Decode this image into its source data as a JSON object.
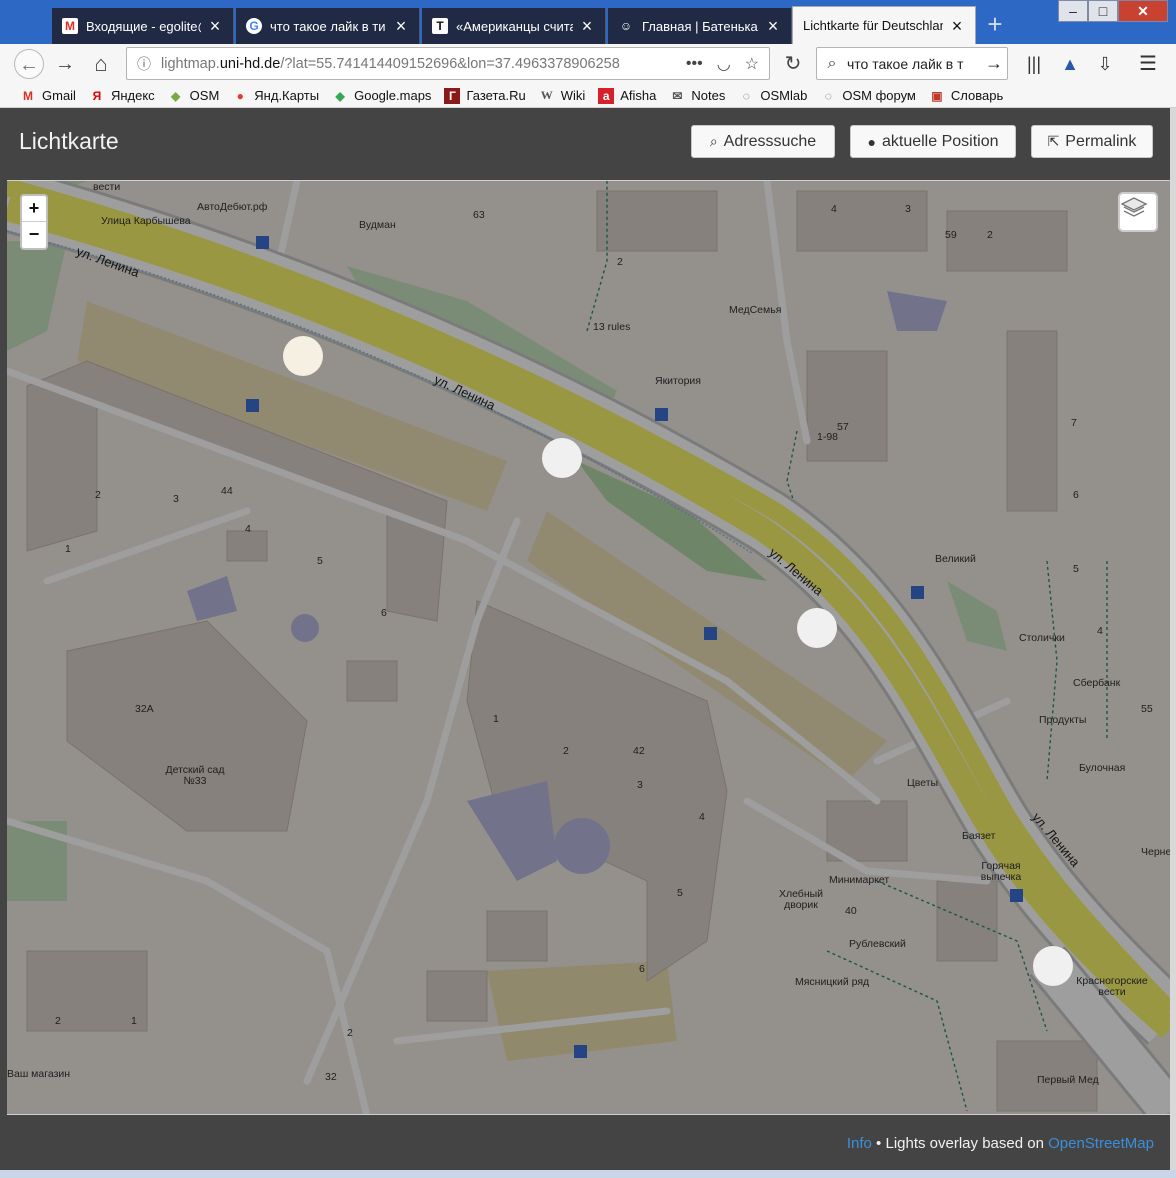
{
  "tabs": [
    {
      "title": "Входящие - egolite@",
      "icon": "M",
      "icon_color": "#d93025"
    },
    {
      "title": "что такое лайк в ти",
      "icon": "G",
      "icon_color": "#4285f4"
    },
    {
      "title": "«Американцы счита",
      "icon": "T",
      "icon_color": "#ffffff"
    },
    {
      "title": "Главная | Батенька,",
      "icon": "☺",
      "icon_color": "#ffffff"
    },
    {
      "title": "Lichtkarte für Deutschlan",
      "icon": "",
      "icon_color": "#ffffff",
      "active": true
    }
  ],
  "window": {
    "minimize": "–",
    "maximize": "□",
    "close": "✕"
  },
  "nav": {
    "back": "←",
    "forward": "→",
    "home": "⌂",
    "url_prefix": "lightmap.",
    "url_domain": "uni-hd.de",
    "url_rest": "/?lat=55.741414409152696&lon=37.4963378906258",
    "reload": "↻",
    "search_value": "что такое лайк в т",
    "search_go": "→"
  },
  "bookmarks": [
    {
      "label": "Gmail",
      "icon": "M",
      "color": "#d93025"
    },
    {
      "label": "Яндекс",
      "icon": "Я",
      "color": "#e00000"
    },
    {
      "label": "OSM",
      "icon": "◆",
      "color": "#7aa843"
    },
    {
      "label": "Янд.Карты",
      "icon": "●",
      "color": "#e63a2e"
    },
    {
      "label": "Google.maps",
      "icon": "◆",
      "color": "#34a853"
    },
    {
      "label": "Газета.Ru",
      "icon": "Г",
      "color": "#8b1a1a"
    },
    {
      "label": "Wiki",
      "icon": "W",
      "color": "#555555"
    },
    {
      "label": "Afisha",
      "icon": "a",
      "color": "#d6202a"
    },
    {
      "label": "Notes",
      "icon": "✉",
      "color": "#555555"
    },
    {
      "label": "OSMlab",
      "icon": "◌",
      "color": "#555555"
    },
    {
      "label": "OSM форум",
      "icon": "◌",
      "color": "#555555"
    },
    {
      "label": "Словарь",
      "icon": "▣",
      "color": "#c0392b"
    }
  ],
  "app": {
    "title": "Lichtkarte",
    "buttons": {
      "address_search": "Adresssuche",
      "current_position": "aktuelle Position",
      "permalink": "Permalink"
    },
    "zoom_in": "+",
    "zoom_out": "−"
  },
  "map": {
    "road_labels": [
      "ул. Ленина",
      "ул. Ленина",
      "ул. Ленина",
      "ул. Ленина"
    ],
    "poi_labels": [
      "вести",
      "АвтоДебют.рф",
      "Улица Карбышева",
      "Вудман",
      "13 rules",
      "МедСемья",
      "Якитория",
      "Великий",
      "Столички",
      "Сбербанк",
      "Продукты",
      "Булочная",
      "Цветы",
      "Баязет",
      "Горячая выпечка",
      "Минимаркет",
      "Хлебный дворик",
      "Рублевский",
      "Мясницкий ряд",
      "Детский сад №33",
      "Красногорские вести",
      "Первый Мед",
      "Ваш магазин",
      "Черне"
    ],
    "house_numbers": [
      "63",
      "4",
      "3",
      "59",
      "2",
      "2",
      "44",
      "3",
      "4",
      "5",
      "6",
      "32А",
      "1",
      "2",
      "42",
      "3",
      "4",
      "5",
      "6",
      "57",
      "1-98",
      "7",
      "6",
      "5",
      "4",
      "55",
      "40",
      "2",
      "1",
      "2",
      "32",
      "2",
      "1"
    ]
  },
  "footer": {
    "info": "Info",
    "text": " • Lights overlay based on ",
    "osm": "OpenStreetMap"
  }
}
